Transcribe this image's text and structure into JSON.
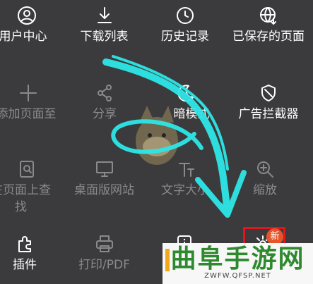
{
  "menu": {
    "row1": {
      "user_center": "用户中心",
      "downloads": "下载列表",
      "history": "历史记录",
      "saved_pages": "已保存的页面"
    },
    "row2": {
      "add_page": "添加页面至",
      "share": "分享",
      "dark_mode": "暗模式",
      "ad_blocker": "广告拦截器"
    },
    "row3": {
      "find_in_page": "在页面上查找",
      "desktop_site": "桌面版网站",
      "text_size": "文字大小",
      "zoom": "缩放"
    },
    "row4": {
      "plugins": "插件",
      "print_pdf": "打印/PDF",
      "new_badge": "新"
    }
  },
  "watermark": {
    "title": "曲阜手游网",
    "url": "ZWFW.QFSP.NET"
  },
  "colors": {
    "background": "#3b3b3d",
    "active_text": "#ffffff",
    "disabled_text": "#8a8a8c",
    "highlight_box": "#e0161c",
    "badge": "#e8542a",
    "arrow": "#2ee6e6"
  }
}
